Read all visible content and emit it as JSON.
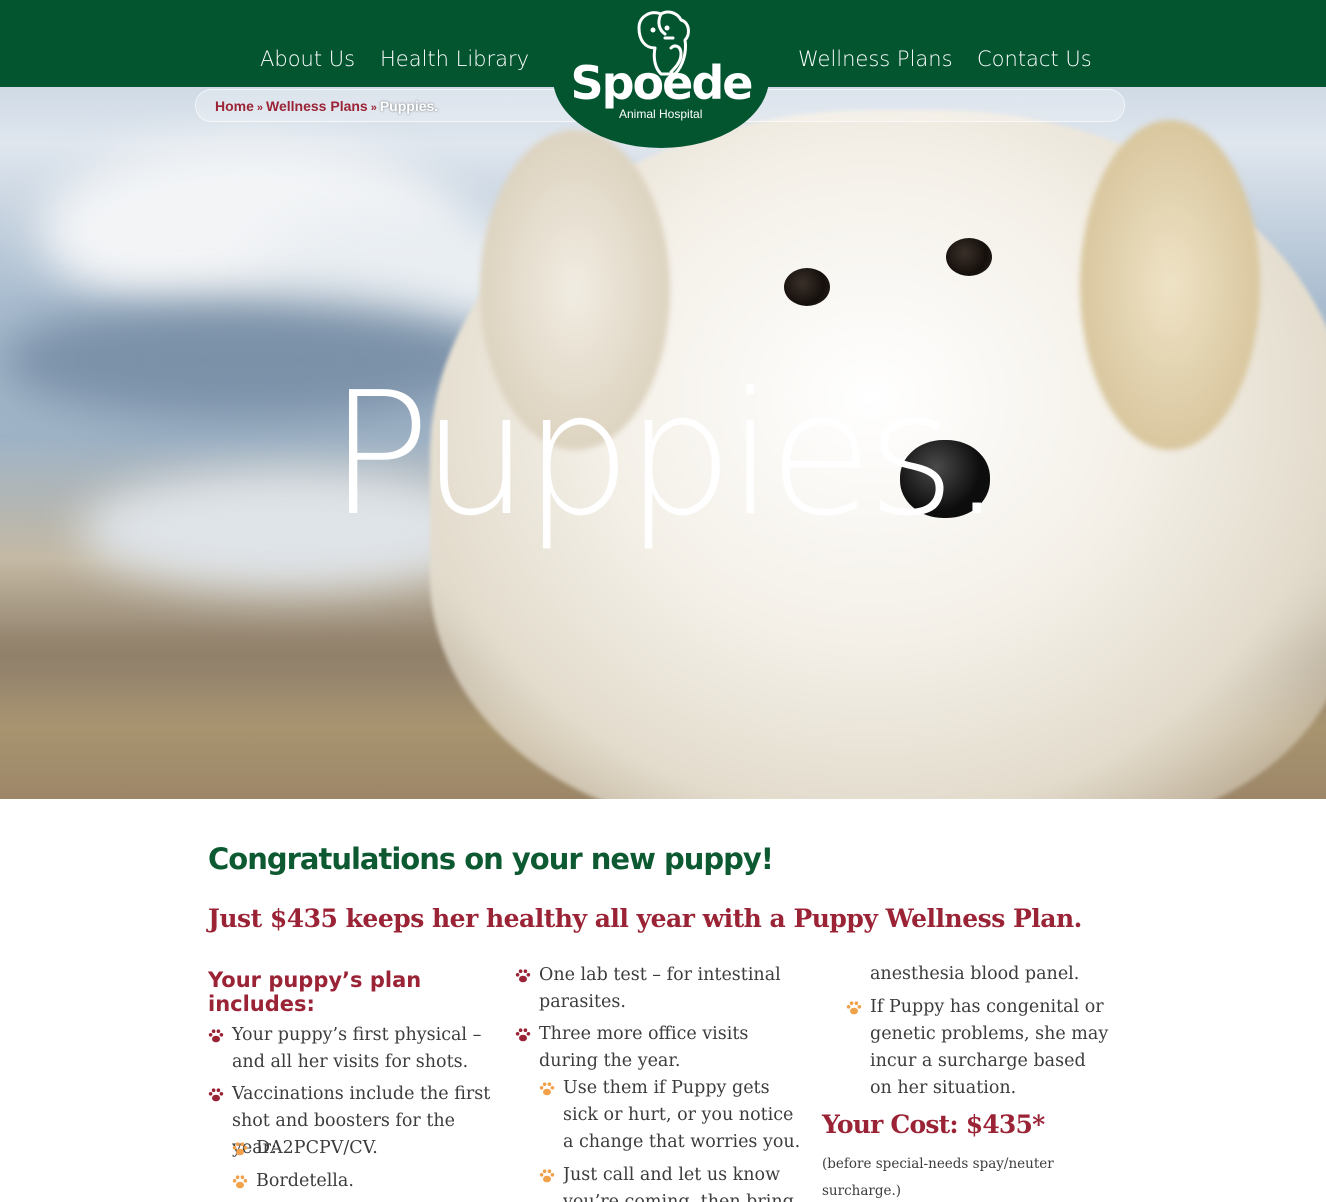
{
  "nav": {
    "about": "About Us",
    "library": "Health Library",
    "wellness": "Wellness Plans",
    "contact": "Contact Us"
  },
  "logo": {
    "name": "Spoede",
    "subtitle": "Animal Hospital"
  },
  "breadcrumb": {
    "home": "Home",
    "section": "Wellness Plans",
    "current": "Puppies.",
    "separator": "»"
  },
  "hero": {
    "title": "Puppies."
  },
  "content": {
    "congrats": "Congratulations on your new puppy!",
    "price_line": "Just $435 keeps her healthy all year with a Puppy Wellness Plan.",
    "plan_heading": "Your puppy’s plan includes:",
    "col1": {
      "item1": "Your puppy’s first physical – and all her visits for shots.",
      "item2": "Vaccinations include the first shot and boosters for the year:",
      "sub1": "DA2PCPV/CV.",
      "sub2": "Bordetella."
    },
    "col2": {
      "item1": "One lab test – for intestinal parasites.",
      "item2": "Three more office visits during the year.",
      "sub1": "Use them if Puppy gets sick or hurt, or you notice a change that worries you.",
      "sub2": "Just call and let us know you’re coming, then bring"
    },
    "col3": {
      "cont": "anesthesia blood panel.",
      "item1": "If Puppy has congenital or genetic problems, she may incur a surcharge based on her situation."
    },
    "cost": "Your Cost: $435*",
    "cost_note": "(before special-needs spay/neuter surcharge.)"
  },
  "colors": {
    "brand_green": "#035530",
    "heading_green": "#0d5a32",
    "accent_red": "#9b2336",
    "paw_orange": "#f0a14a",
    "text": "#3c3c3c"
  }
}
